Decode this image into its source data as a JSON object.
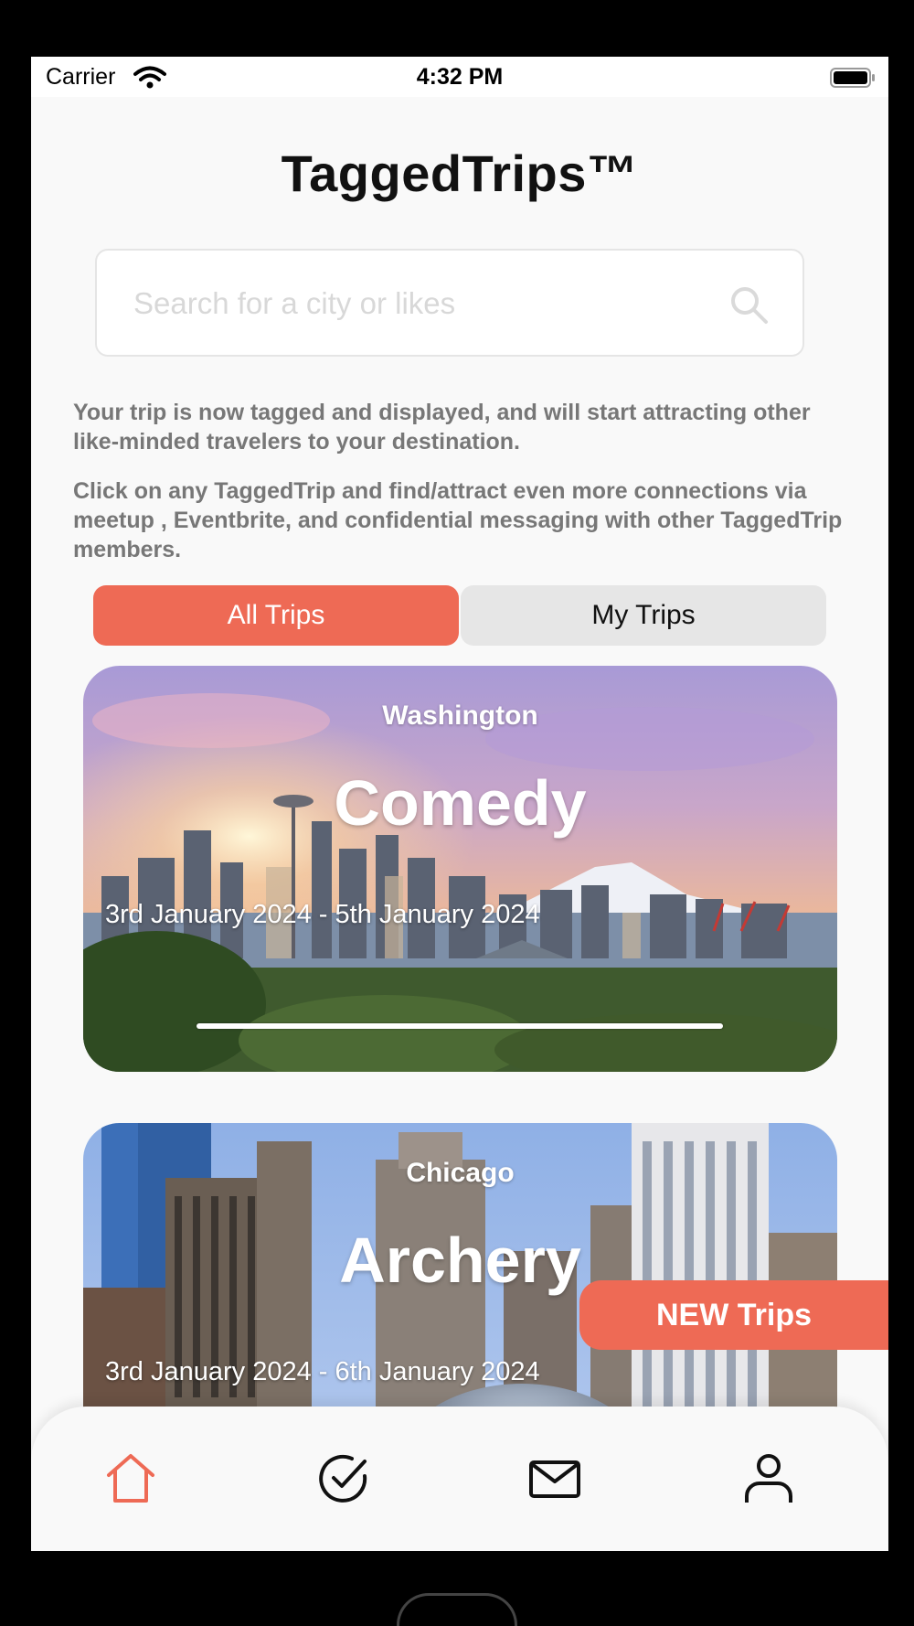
{
  "status_bar": {
    "carrier": "Carrier",
    "time": "4:32 PM"
  },
  "app": {
    "title": "TaggedTrips™"
  },
  "search": {
    "placeholder": "Search for a city or likes",
    "value": ""
  },
  "info": {
    "paragraph1": "Your trip is now tagged and displayed, and will start attracting other like-minded travelers to your destination.",
    "paragraph2": "Click on any TaggedTrip and find/attract even more connections via meetup , Eventbrite, and confidential messaging with other TaggedTrip members."
  },
  "segments": {
    "all": "All Trips",
    "mine": "My Trips",
    "selected": "All Trips"
  },
  "cards": [
    {
      "city": "Washington",
      "title": "Comedy",
      "dates": "3rd January 2024 - 5th January 2024"
    },
    {
      "city": "Chicago",
      "title": "Archery",
      "dates": "3rd January 2024 - 6th January 2024"
    }
  ],
  "new_trips_button": "NEW Trips",
  "tabs": [
    {
      "name": "home",
      "icon": "home-icon",
      "active": true
    },
    {
      "name": "tasks",
      "icon": "check-circle-icon",
      "active": false
    },
    {
      "name": "messages",
      "icon": "mail-icon",
      "active": false
    },
    {
      "name": "profile",
      "icon": "user-icon",
      "active": false
    }
  ],
  "colors": {
    "accent": "#ee6a55",
    "segment_inactive": "#e6e6e6",
    "background": "#f9f9f9"
  }
}
